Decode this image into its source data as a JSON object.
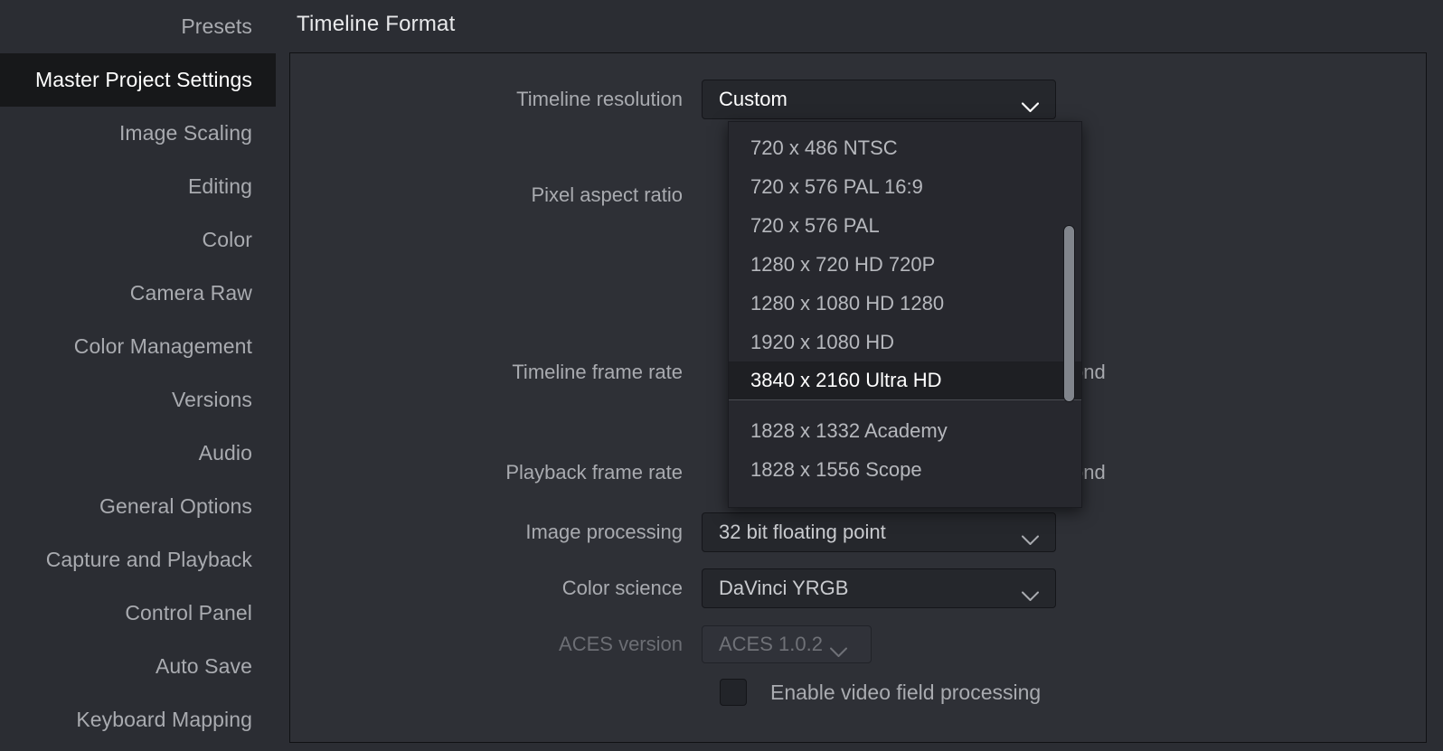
{
  "sidebar": {
    "items": [
      {
        "label": "Presets",
        "selected": false
      },
      {
        "label": "Master Project Settings",
        "selected": true
      },
      {
        "label": "Image Scaling",
        "selected": false
      },
      {
        "label": "Editing",
        "selected": false
      },
      {
        "label": "Color",
        "selected": false
      },
      {
        "label": "Camera Raw",
        "selected": false
      },
      {
        "label": "Color Management",
        "selected": false
      },
      {
        "label": "Versions",
        "selected": false
      },
      {
        "label": "Audio",
        "selected": false
      },
      {
        "label": "General Options",
        "selected": false
      },
      {
        "label": "Capture and Playback",
        "selected": false
      },
      {
        "label": "Control Panel",
        "selected": false
      },
      {
        "label": "Auto Save",
        "selected": false
      },
      {
        "label": "Keyboard Mapping",
        "selected": false
      }
    ]
  },
  "header": {
    "title": "Timeline Format"
  },
  "form": {
    "timeline_resolution": {
      "label": "Timeline resolution",
      "value": "Custom"
    },
    "pixel_aspect_ratio": {
      "label": "Pixel aspect ratio"
    },
    "timeline_frame_rate": {
      "label": "Timeline frame rate",
      "suffix": "ond"
    },
    "playback_frame_rate": {
      "label": "Playback frame rate",
      "suffix": "ond"
    },
    "image_processing": {
      "label": "Image processing",
      "value": "32 bit floating point"
    },
    "color_science": {
      "label": "Color science",
      "value": "DaVinci YRGB"
    },
    "aces_version": {
      "label": "ACES version",
      "value": "ACES 1.0.2",
      "disabled": true
    },
    "enable_video_field_processing": {
      "label": "Enable video field processing",
      "checked": false
    }
  },
  "dropdown": {
    "open": true,
    "options": [
      {
        "label": "720 x 486 NTSC",
        "highlight": false
      },
      {
        "label": "720 x 576 PAL 16:9",
        "highlight": false
      },
      {
        "label": "720 x 576 PAL",
        "highlight": false
      },
      {
        "label": "1280 x 720 HD 720P",
        "highlight": false
      },
      {
        "label": "1280 x 1080 HD 1280",
        "highlight": false
      },
      {
        "label": "1920 x 1080 HD",
        "highlight": false
      },
      {
        "label": "3840 x 2160 Ultra HD",
        "highlight": true
      },
      {
        "label": "1828 x 1332 Academy",
        "highlight": false
      },
      {
        "label": "1828 x 1556 Scope",
        "highlight": false
      }
    ]
  },
  "colors": {
    "window_background": "#2b2d33",
    "panel_background": "#2e3036",
    "sidebar_selected_background": "#17181a",
    "dropdown_background": "#27282e",
    "dropdown_highlight_background": "#1e1f23",
    "text_primary": "#ffffff",
    "text_secondary": "#a9abb0",
    "text_disabled": "#6c6e74",
    "scrollbar_thumb": "#81858c"
  }
}
